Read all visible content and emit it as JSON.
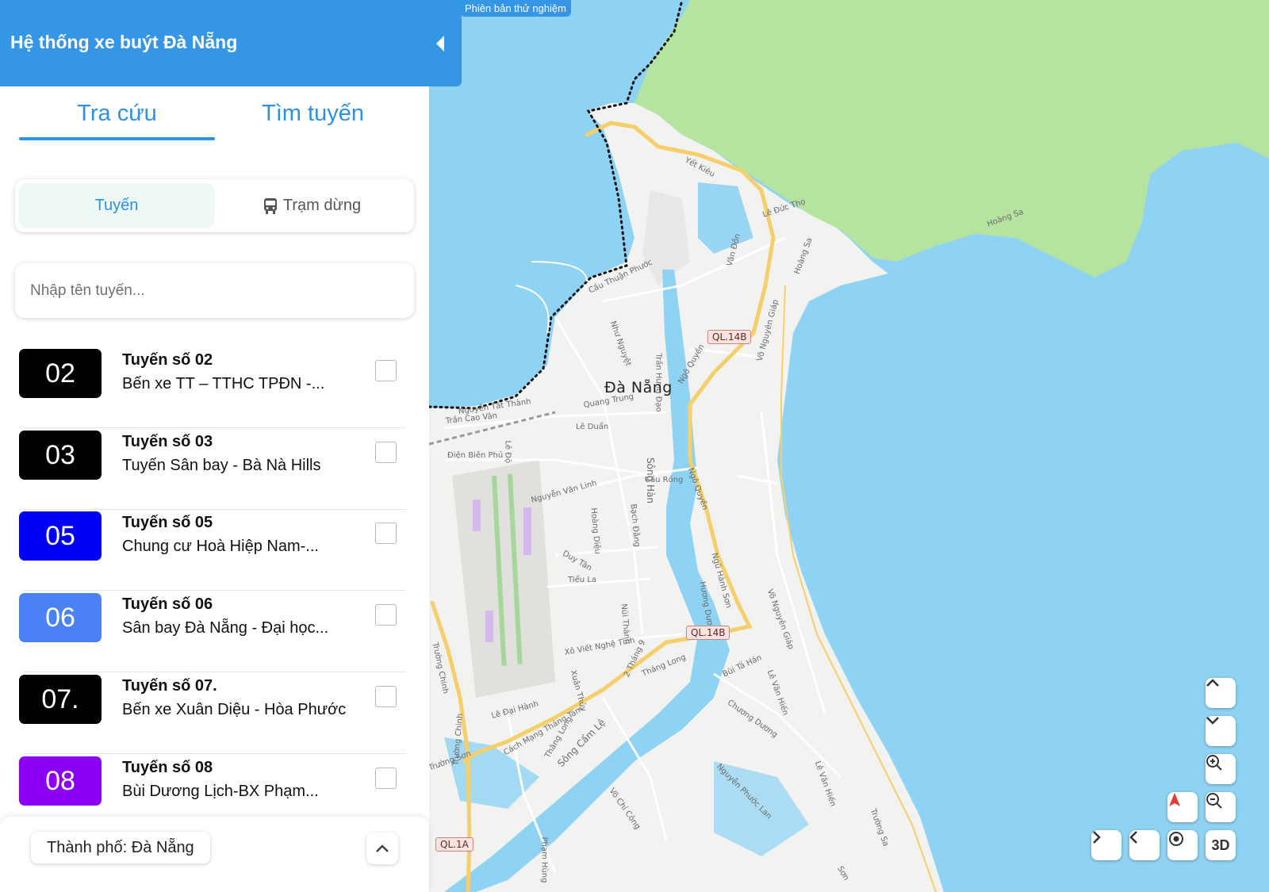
{
  "app": {
    "title": "Hệ thống xe buýt Đà Nẵng",
    "beta_label": "Phiên bản thử nghiệm"
  },
  "tabs": [
    {
      "label": "Tra cứu",
      "active": true
    },
    {
      "label": "Tìm tuyến",
      "active": false
    }
  ],
  "segment": {
    "route_label": "Tuyến",
    "stop_label": "Trạm dừng",
    "stop_icon": "bus-icon"
  },
  "search": {
    "placeholder": "Nhập tên tuyến...",
    "value": ""
  },
  "routes": [
    {
      "code": "02",
      "name": "Tuyến số 02",
      "desc": "Bến xe TT – TTHC TPĐN -...",
      "color": "#000000",
      "checked": false
    },
    {
      "code": "03",
      "name": "Tuyến số 03",
      "desc": "Tuyến Sân bay - Bà Nà Hills",
      "color": "#000000",
      "checked": false
    },
    {
      "code": "05",
      "name": "Tuyến số 05",
      "desc": "Chung cư Hoà Hiệp Nam-...",
      "color": "#0000f5",
      "checked": false
    },
    {
      "code": "06",
      "name": "Tuyến số 06",
      "desc": "Sân bay Đà Nẵng - Đại học...",
      "color": "#4a82f5",
      "checked": false
    },
    {
      "code": "07.",
      "name": "Tuyến số 07.",
      "desc": "Bến xe Xuân Diệu - Hòa Phước",
      "color": "#000000",
      "checked": false
    },
    {
      "code": "08",
      "name": "Tuyến số 08",
      "desc": "Bùi Dương Lịch-BX Phạm...",
      "color": "#8b00f5",
      "checked": false
    }
  ],
  "footer": {
    "city_label": "Thành phố: Đà Nẵng"
  },
  "map": {
    "city": "Đà Nẵng",
    "water_color": "#8fd3f4",
    "land_color": "#f2f2f0",
    "park_color": "#b5e3a0",
    "shields": [
      "QL.14B",
      "QL.14B",
      "QL.1A"
    ],
    "streets": [
      "Yết Kiêu",
      "Lê Đức Thọ",
      "Hoàng Sa",
      "Vân Đồn",
      "Cầu Thuận Phước",
      "Như Nguyệt",
      "Trần Hưng Đạo",
      "Hoàng Sa",
      "Võ Nguyên Giáp",
      "Ngô Quyền",
      "Quang Trung",
      "Nguyễn Tất Thành",
      "Trần Cao Vân",
      "Lê Độ",
      "Lê Duẩn",
      "Điện Biên Phủ",
      "Sông Hàn",
      "Cầu Rồng",
      "Ngô Quyền",
      "Nguyễn Văn Linh",
      "Hoàng Diệu",
      "Bạch Đằng",
      "Duy Tân",
      "Ngũ Hành Sơn",
      "Tiểu La",
      "Hương Dương",
      "Võ Nguyên Giáp",
      "Núi Thành",
      "Xô Viết Nghệ Tĩnh",
      "2 Tháng 9",
      "Tháng Long",
      "Bùi Tá Hán",
      "Lê Văn Hiến",
      "Xuân Thủy",
      "Trường Chinh",
      "Lê Đại Hành",
      "Cách Mạng Tháng Tám",
      "Chương Dương",
      "Trường Sơn",
      "Trường Chinh",
      "Thăng Long",
      "Sông Cẩm Lệ",
      "Nguyễn Phước Lan",
      "Lê Văn Hiến",
      "Võ Chí Công",
      "Phạm Hùng",
      "Trường Sa",
      "Sơn"
    ]
  },
  "map_controls": {
    "up": "chevron-up-icon",
    "down": "chevron-down-icon",
    "zoom_in": "zoom-in-icon",
    "zoom_out": "zoom-out-icon",
    "compass": "compass-icon",
    "next": "chevron-right-icon",
    "prev": "chevron-left-icon",
    "locate": "locate-icon",
    "mode_3d": "3D"
  }
}
